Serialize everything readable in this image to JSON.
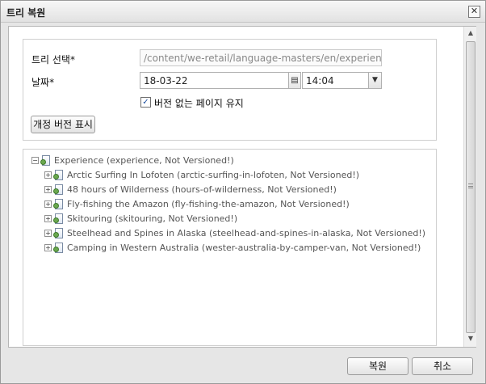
{
  "dialog": {
    "title": "트리 복원",
    "close_icon": "close-icon"
  },
  "form": {
    "tree_label": "트리 선택*",
    "tree_path_value": "/content/we-retail/language-masters/en/experience",
    "date_label": "날짜*",
    "date_value": "18-03-22",
    "date_trigger_icon": "calendar-icon",
    "time_value": "14:04",
    "time_trigger_icon": "chevron-down-icon",
    "preserve_checkbox_checked": true,
    "preserve_label": "버전 없는 페이지 유지",
    "show_versions_button": "개정 버전 표시"
  },
  "tree": {
    "root": {
      "label": "Experience (experience, Not Versioned!)",
      "expanded": true
    },
    "children": [
      {
        "label": "Arctic Surfing In Lofoten (arctic-surfing-in-lofoten, Not Versioned!)"
      },
      {
        "label": "48 hours of Wilderness (hours-of-wilderness, Not Versioned!)"
      },
      {
        "label": "Fly-fishing the Amazon (fly-fishing-the-amazon, Not Versioned!)"
      },
      {
        "label": "Skitouring (skitouring, Not Versioned!)"
      },
      {
        "label": "Steelhead and Spines in Alaska (steelhead-and-spines-in-alaska, Not Versioned!)"
      },
      {
        "label": "Camping in Western Australia (wester-australia-by-camper-van, Not Versioned!)"
      }
    ]
  },
  "footer": {
    "restore_button": "복원",
    "cancel_button": "취소"
  },
  "symbols": {
    "close": "✕",
    "check": "✓",
    "calendar": "▤",
    "chevron_down": "▼",
    "collapse": "−",
    "expand": "+",
    "scroll_up": "▲",
    "scroll_down": "▼"
  }
}
